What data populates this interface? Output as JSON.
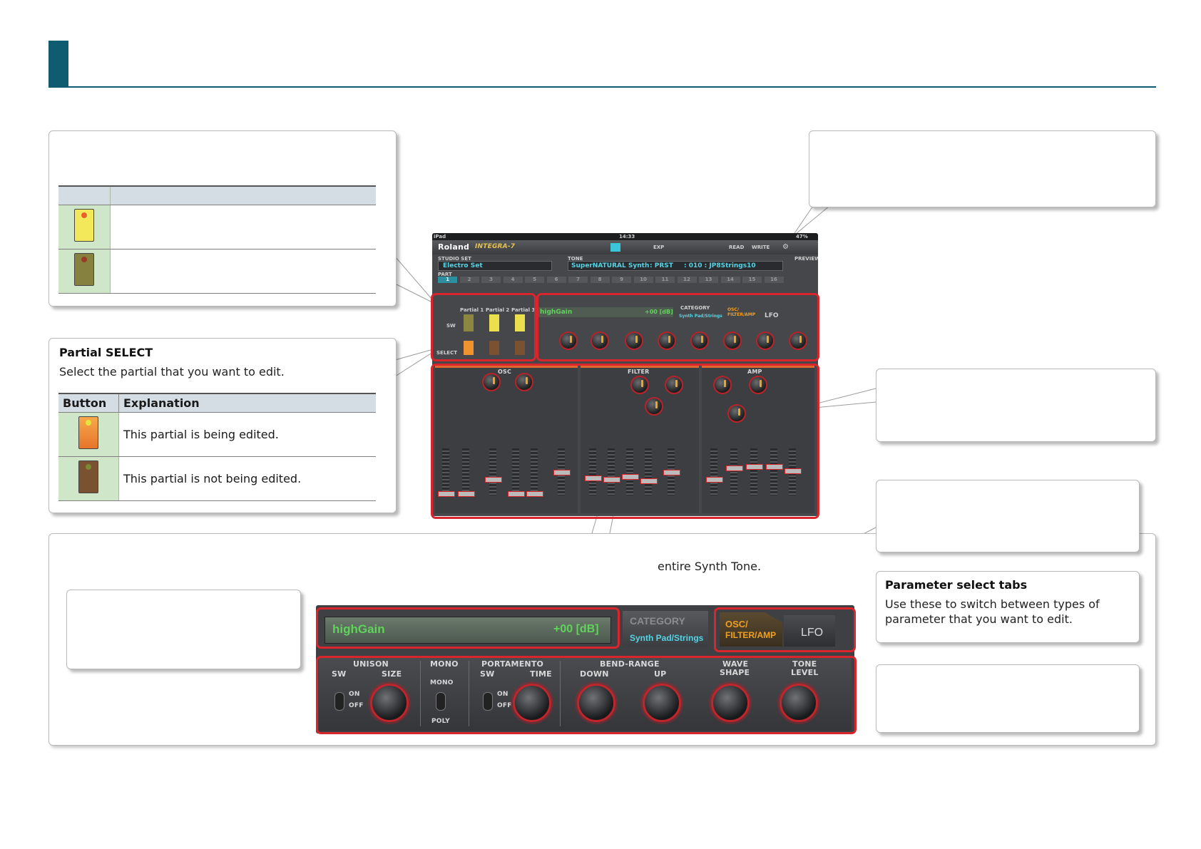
{
  "partial_select_callout": {
    "title": "Partial SELECT",
    "description": "Select the partial that you want to edit.",
    "table": {
      "headers": [
        "Button",
        "Explanation"
      ],
      "rows": [
        {
          "icon": "orange-partial-button-icon",
          "text": "This partial is being edited."
        },
        {
          "icon": "brown-partial-button-icon",
          "text": "This partial is not being edited."
        }
      ]
    }
  },
  "common_panel_text": "entire Synth Tone.",
  "parameter_tabs_callout": {
    "title": "Parameter select tabs",
    "description": "Use these to switch between types of parameter that you want to edit."
  },
  "ipad": {
    "status_left": "iPad",
    "time": "14:33",
    "battery": "47%",
    "brand": "Roland",
    "product": "INTEGRA-7",
    "exp": "EXP",
    "read": "READ",
    "write": "WRITE",
    "studio_set_label": "STUDIO SET",
    "studio_set": "Electro Set",
    "tone_label": "TONE",
    "tone_type": "SuperNATURAL Synth",
    "tone_bank": ": PRST",
    "tone_number": ": 010 : JP8Strings10",
    "preview": "PREVIEW",
    "part_label": "PART",
    "parts": [
      "1",
      "2",
      "3",
      "4",
      "5",
      "6",
      "7",
      "8",
      "9",
      "10",
      "11",
      "12",
      "13",
      "14",
      "15",
      "16"
    ],
    "sw_label": "SW",
    "select_label": "SELECT",
    "partials": [
      "Partial 1",
      "Partial 2",
      "Partial 3"
    ],
    "name_value": "highGain",
    "level_value": "+00 [dB]",
    "category_label": "CATEGORY",
    "category_value": "Synth Pad/Strings",
    "tab_osc": "OSC/ FILTER/AMP",
    "tab_lfo": "LFO",
    "sections": [
      "OSC",
      "FILTER",
      "AMP"
    ]
  },
  "zoom": {
    "name_value": "highGain",
    "level_value": "+00 [dB]",
    "category_label": "CATEGORY",
    "category_value": "Synth Pad/Strings",
    "tab_osc_line1": "OSC/",
    "tab_osc_line2": "FILTER/AMP",
    "tab_lfo": "LFO",
    "groups": {
      "unison": "UNISON",
      "mono": "MONO",
      "portamento": "PORTAMENTO",
      "bend_range": "BEND-RANGE",
      "wave_shape_1": "WAVE",
      "wave_shape_2": "SHAPE",
      "tone_level_1": "TONE",
      "tone_level_2": "LEVEL"
    },
    "sub": {
      "sw": "SW",
      "size": "SIZE",
      "mono": "MONO",
      "poly": "POLY",
      "time": "TIME",
      "down": "DOWN",
      "up": "UP",
      "on": "ON",
      "off": "OFF"
    }
  },
  "colors": {
    "accent": "#0f5b70",
    "highlight_red": "#d9262c",
    "lcd_green": "#5fd35a",
    "knob_orange": "#f0a520",
    "tab_orange": "#f0a020"
  }
}
